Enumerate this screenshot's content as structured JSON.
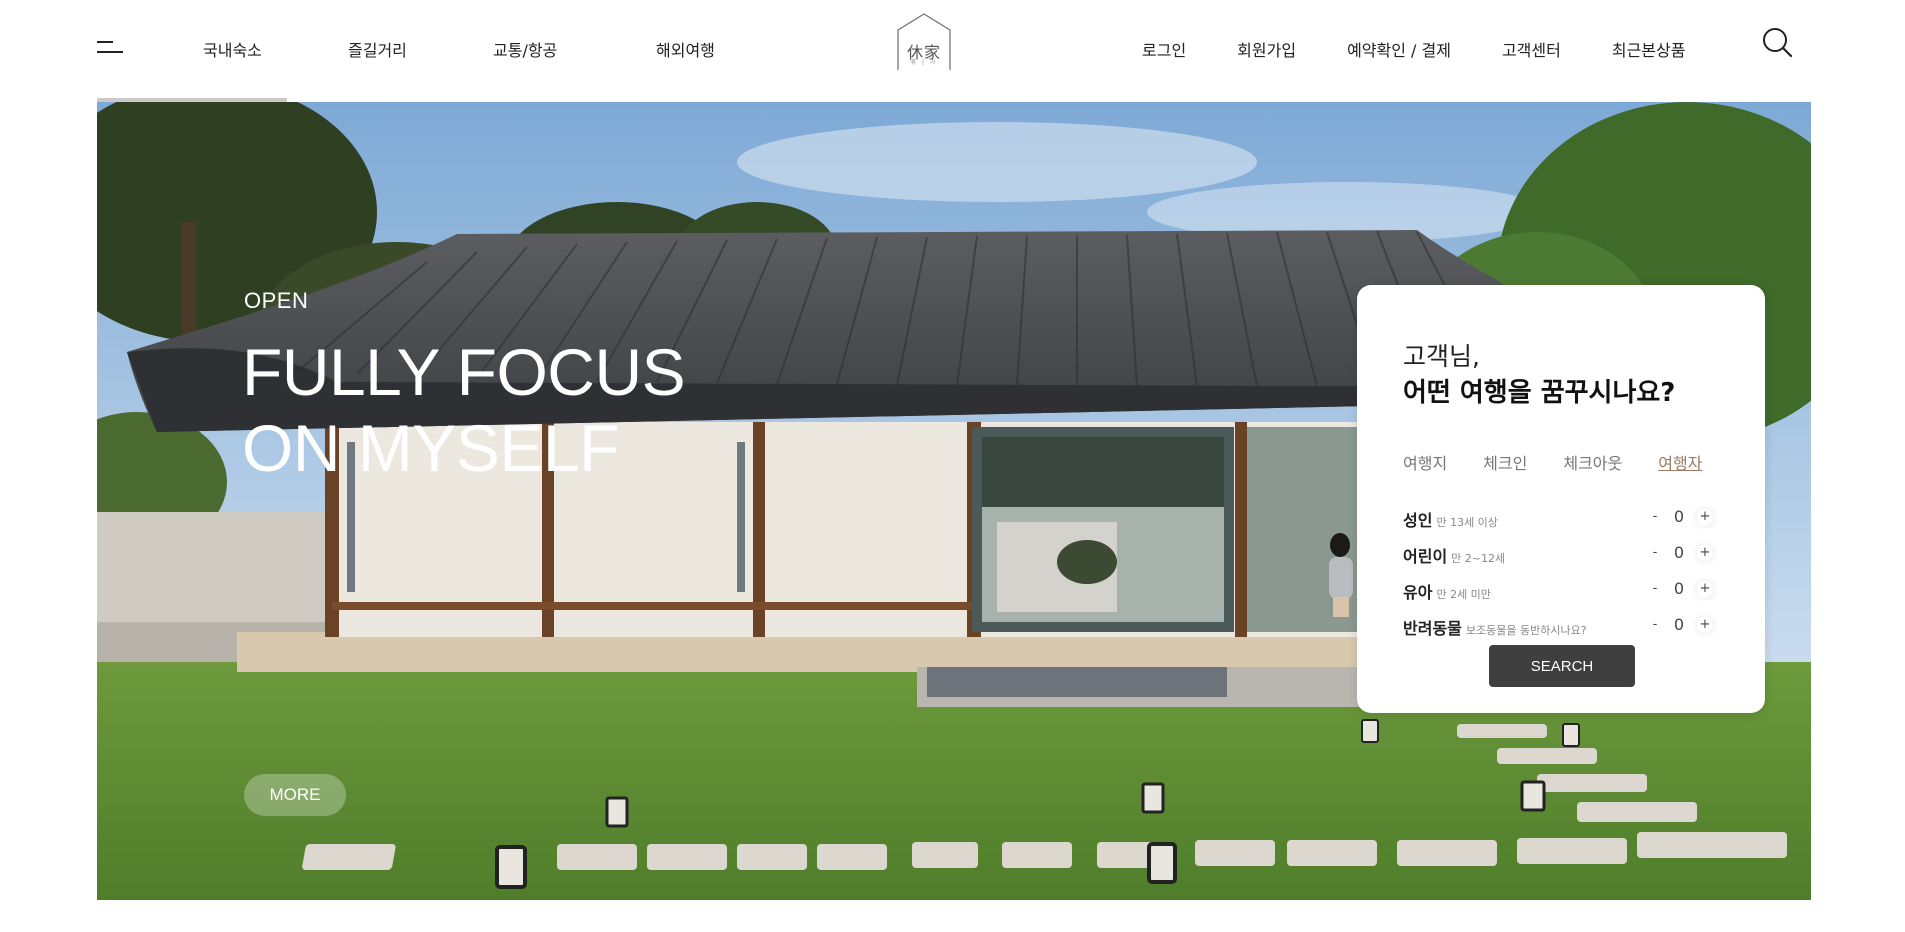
{
  "header": {
    "nav_left": [
      "국내숙소",
      "즐길거리",
      "교통/항공",
      "해외여행"
    ],
    "logo": {
      "main": "休家",
      "sub": "휴 | 가"
    },
    "nav_right": [
      "로그인",
      "회원가입",
      "예약확인 / 결제",
      "고객센터",
      "최근본상품"
    ]
  },
  "hero": {
    "eyebrow": "OPEN",
    "title_line1": "FULLY FOCUS",
    "title_line2": "ON MYSELF",
    "more_label": "MORE"
  },
  "booking": {
    "greeting": "고객님,",
    "question": "어떤 여행을 꿈꾸시나요?",
    "tabs": [
      "여행지",
      "체크인",
      "체크아웃",
      "여행자"
    ],
    "active_tab": "여행자",
    "guests": [
      {
        "label": "성인",
        "sub": "만 13세 이상",
        "count": "0"
      },
      {
        "label": "어린이",
        "sub": "만 2~12세",
        "count": "0"
      },
      {
        "label": "유아",
        "sub": "만 2세 미만",
        "count": "0"
      },
      {
        "label": "반려동물",
        "sub": "보조동물을 동반하시나요?",
        "count": "0"
      }
    ],
    "minus": "-",
    "plus": "+",
    "search_label": "SEARCH"
  }
}
